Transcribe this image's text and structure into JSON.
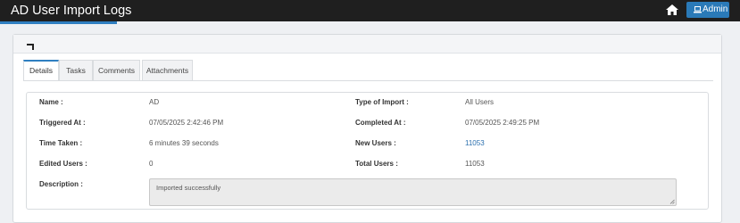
{
  "header": {
    "title": "AD User Import Logs",
    "admin_label": "Admin",
    "home_icon": "home-icon",
    "admin_icon": "laptop-icon"
  },
  "toolbar": {
    "back_icon": "back-arrow-icon"
  },
  "tabs": [
    {
      "label": "Details",
      "active": true
    },
    {
      "label": "Tasks",
      "active": false
    },
    {
      "label": "Comments",
      "active": false
    },
    {
      "label": "Attachments",
      "active": false
    }
  ],
  "details": {
    "name_label": "Name :",
    "name_value": "AD",
    "type_label": "Type of Import :",
    "type_value": "All Users",
    "triggered_label": "Triggered At :",
    "triggered_value": "07/05/2025 2:42:46 PM",
    "completed_label": "Completed At :",
    "completed_value": "07/05/2025 2:49:25 PM",
    "time_label": "Time Taken :",
    "time_value": "6 minutes 39 seconds",
    "new_label": "New Users :",
    "new_value": "11053",
    "edited_label": "Edited Users :",
    "edited_value": "0",
    "total_label": "Total Users :",
    "total_value": "11053",
    "description_label": "Description :",
    "description_value": "Imported successfully"
  },
  "colors": {
    "topbar": "#1f1f1f",
    "accent": "#2f7fc1",
    "admin_button": "#2a7ab8",
    "link": "#2a6fae"
  }
}
